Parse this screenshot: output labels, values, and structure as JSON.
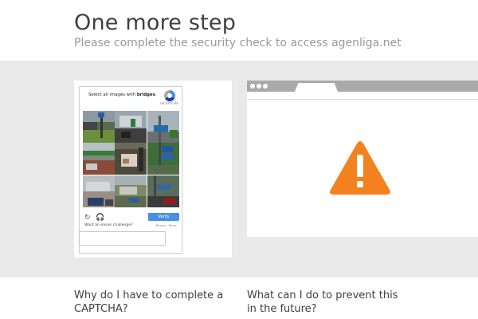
{
  "header": {
    "title": "One more step",
    "subtitle": "Please complete the security check to access agenliga.net"
  },
  "recaptcha": {
    "prompt_prefix": "Select all images with ",
    "prompt_target": "bridges",
    "prompt_suffix": ".",
    "brand": "reCAPTCHA",
    "verify_label": "Verify",
    "easier_challenge": "Want an easier challenge?",
    "terms": "Privacy - Terms",
    "icons": [
      "reload-icon",
      "audio-icon"
    ]
  },
  "browser": {
    "icon": "warning-icon",
    "warning_color": "#f48120"
  },
  "faq": {
    "left_title": "Why do I have to complete a CAPTCHA?",
    "right_title": "What can I do to prevent this in the future?"
  },
  "colors": {
    "band": "#e9e9e9",
    "verify_button": "#4a90e2",
    "browser_bar": "#a9a9a9"
  }
}
